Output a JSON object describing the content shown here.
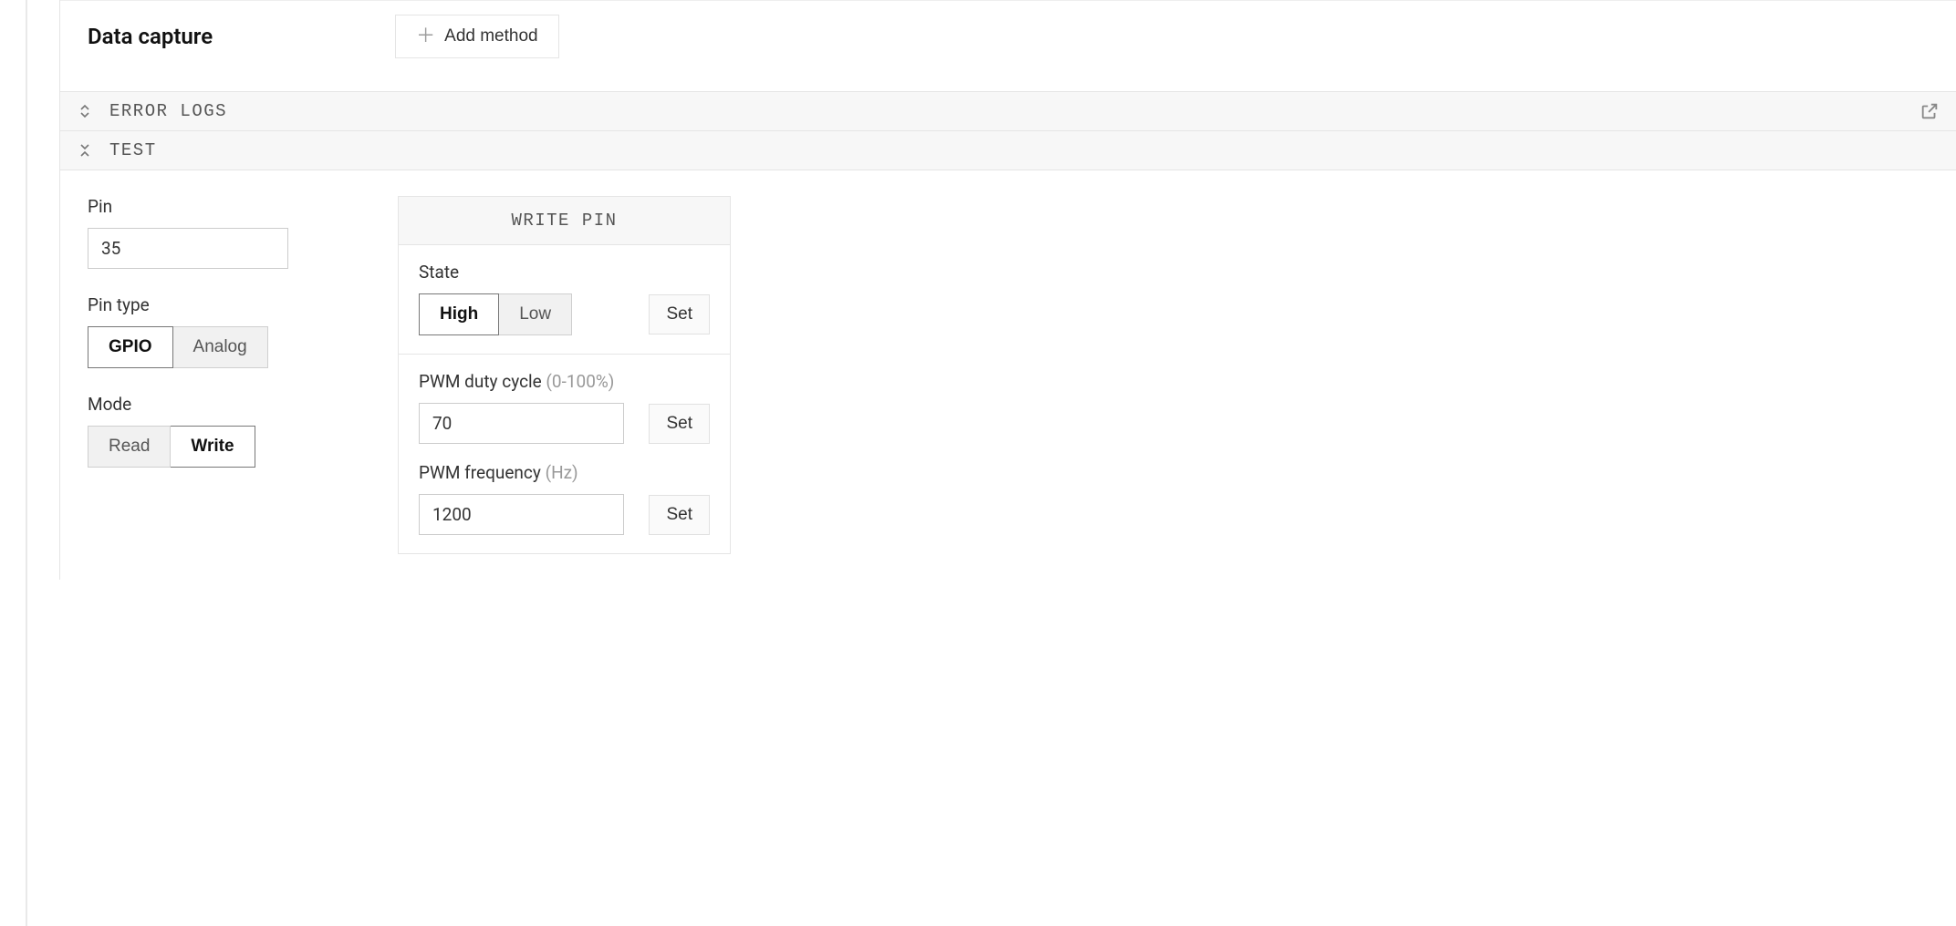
{
  "data_capture": {
    "title": "Data capture",
    "add_method_label": "Add method"
  },
  "error_logs": {
    "label": "ERROR LOGS"
  },
  "test": {
    "label": "TEST",
    "pin": {
      "label": "Pin",
      "value": "35"
    },
    "pin_type": {
      "label": "Pin type",
      "options": {
        "gpio": "GPIO",
        "analog": "Analog"
      }
    },
    "mode": {
      "label": "Mode",
      "options": {
        "read": "Read",
        "write": "Write"
      }
    },
    "write_pin": {
      "title": "WRITE PIN",
      "state": {
        "label": "State",
        "options": {
          "high": "High",
          "low": "Low"
        },
        "set_label": "Set"
      },
      "pwm_duty": {
        "label": "PWM duty cycle ",
        "hint": "(0-100%)",
        "value": "70",
        "set_label": "Set"
      },
      "pwm_freq": {
        "label": "PWM frequency ",
        "hint": "(Hz)",
        "value": "1200",
        "set_label": "Set"
      }
    }
  }
}
